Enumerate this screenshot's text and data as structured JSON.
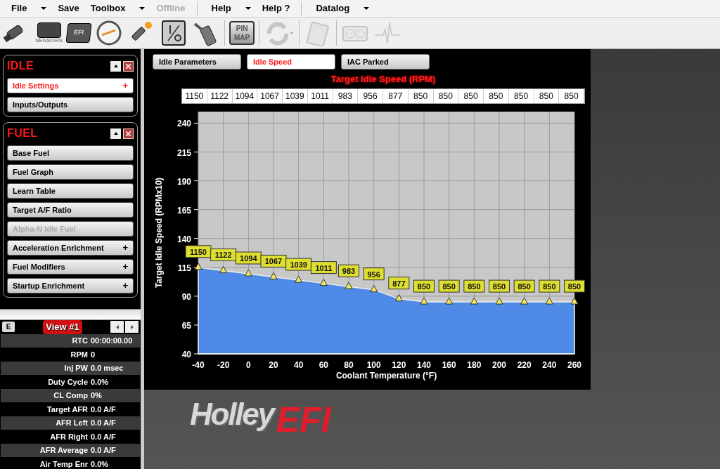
{
  "menu": [
    {
      "label": "File",
      "dropdown": true,
      "disabled": false,
      "separator_before": false
    },
    {
      "label": "Save",
      "dropdown": false,
      "disabled": false,
      "separator_before": false
    },
    {
      "label": "Toolbox",
      "dropdown": true,
      "disabled": false,
      "separator_before": false
    },
    {
      "label": "Offline",
      "dropdown": false,
      "disabled": true,
      "separator_before": false
    },
    {
      "label": "Help",
      "dropdown": true,
      "disabled": false,
      "separator_before": true
    },
    {
      "label": "Help ?",
      "dropdown": false,
      "disabled": false,
      "separator_before": false
    },
    {
      "label": "Datalog",
      "dropdown": true,
      "disabled": false,
      "separator_before": true
    }
  ],
  "toolbar": [
    {
      "kind": "injector",
      "disabled": false
    },
    {
      "kind": "sensors",
      "label": "SENSORS",
      "disabled": false
    },
    {
      "kind": "ecu",
      "label": "EFI",
      "disabled": false
    },
    {
      "kind": "gauge",
      "disabled": false
    },
    {
      "kind": "sparkplug",
      "disabled": false
    },
    {
      "kind": "io",
      "disabled": false
    },
    {
      "kind": "pedal",
      "disabled": false
    },
    {
      "kind": "pinmap",
      "label": "PIN MAP",
      "disabled": false
    },
    {
      "kind": "refresh",
      "disabled": true
    },
    {
      "kind": "clipboard",
      "disabled": true
    },
    {
      "kind": "dashboard",
      "disabled": true
    },
    {
      "kind": "pulse",
      "disabled": true
    }
  ],
  "sidebar": {
    "panels": [
      {
        "title": "IDLE",
        "items": [
          {
            "label": "Idle Settings",
            "selected": true,
            "disabled": false,
            "plus": "+"
          },
          {
            "label": "Inputs/Outputs",
            "selected": false,
            "disabled": false
          }
        ]
      },
      {
        "title": "FUEL",
        "items": [
          {
            "label": "Base Fuel",
            "selected": false,
            "disabled": false
          },
          {
            "label": "Fuel Graph",
            "selected": false,
            "disabled": false
          },
          {
            "label": "Learn Table",
            "selected": false,
            "disabled": false
          },
          {
            "label": "Target A/F Ratio",
            "selected": false,
            "disabled": false
          },
          {
            "label": "Alpha-N Idle Fuel",
            "selected": false,
            "disabled": true
          },
          {
            "label": "Acceleration Enrichment",
            "selected": false,
            "disabled": false,
            "plus": "+"
          },
          {
            "label": "Fuel Modifiers",
            "selected": false,
            "disabled": false,
            "plus": "+"
          },
          {
            "label": "Startup Enrichment",
            "selected": false,
            "disabled": false,
            "plus": "+"
          }
        ]
      }
    ]
  },
  "view_panel": {
    "edit_button": "E",
    "title": "View #1",
    "rows": [
      {
        "label": "RTC",
        "value": "00:00:00.00"
      },
      {
        "label": "RPM",
        "value": "0"
      },
      {
        "label": "Inj PW",
        "value": "0.0 msec"
      },
      {
        "label": "Duty Cycle",
        "value": "0.0%"
      },
      {
        "label": "CL Comp",
        "value": "0%"
      },
      {
        "label": "Target AFR",
        "value": "0.0 A/F"
      },
      {
        "label": "AFR Left",
        "value": "0.0 A/F"
      },
      {
        "label": "AFR Right",
        "value": "0.0 A/F"
      },
      {
        "label": "AFR Average",
        "value": "0.0 A/F"
      },
      {
        "label": "Air Temp Enr",
        "value": "0.0%"
      }
    ]
  },
  "tabs": [
    {
      "label": "Idle Parameters",
      "selected": false
    },
    {
      "label": "Idle Speed",
      "selected": true
    },
    {
      "label": "IAC Parked",
      "selected": false
    }
  ],
  "table_title": "Target Idle Speed (RPM)",
  "table_values": [
    "1150",
    "1122",
    "1094",
    "1067",
    "1039",
    "1011",
    "983",
    "956",
    "877",
    "850",
    "850",
    "850",
    "850",
    "850",
    "850",
    "850"
  ],
  "chart_data": {
    "type": "area",
    "xlabel": "Coolant Temperature (°F)",
    "ylabel": "Target Idle Speed (RPMx10)",
    "x": [
      -40,
      -20,
      0,
      20,
      40,
      60,
      80,
      100,
      120,
      140,
      160,
      180,
      200,
      220,
      240,
      260
    ],
    "grid": true,
    "series": [
      {
        "color": "#4f8be6",
        "values": [
          115,
          112.2,
          109.4,
          106.7,
          103.9,
          101.1,
          98.3,
          95.6,
          87.7,
          85,
          85,
          85,
          85,
          85,
          85,
          85
        ]
      }
    ],
    "value_labels": [
      "1150",
      "1122",
      "1094",
      "1067",
      "1039",
      "1011",
      "983",
      "956",
      "877",
      "850",
      "850",
      "850",
      "850",
      "850",
      "850",
      "850"
    ],
    "xlim": [
      -40,
      260
    ],
    "ylim": [
      40,
      250
    ],
    "xticks": [
      -40,
      -20,
      0,
      20,
      40,
      60,
      80,
      100,
      120,
      140,
      160,
      180,
      200,
      220,
      240,
      260
    ],
    "yticks": [
      40,
      65,
      90,
      115,
      140,
      165,
      190,
      215,
      240
    ]
  },
  "logo": {
    "word1": "Holley",
    "word2": "EFI"
  }
}
